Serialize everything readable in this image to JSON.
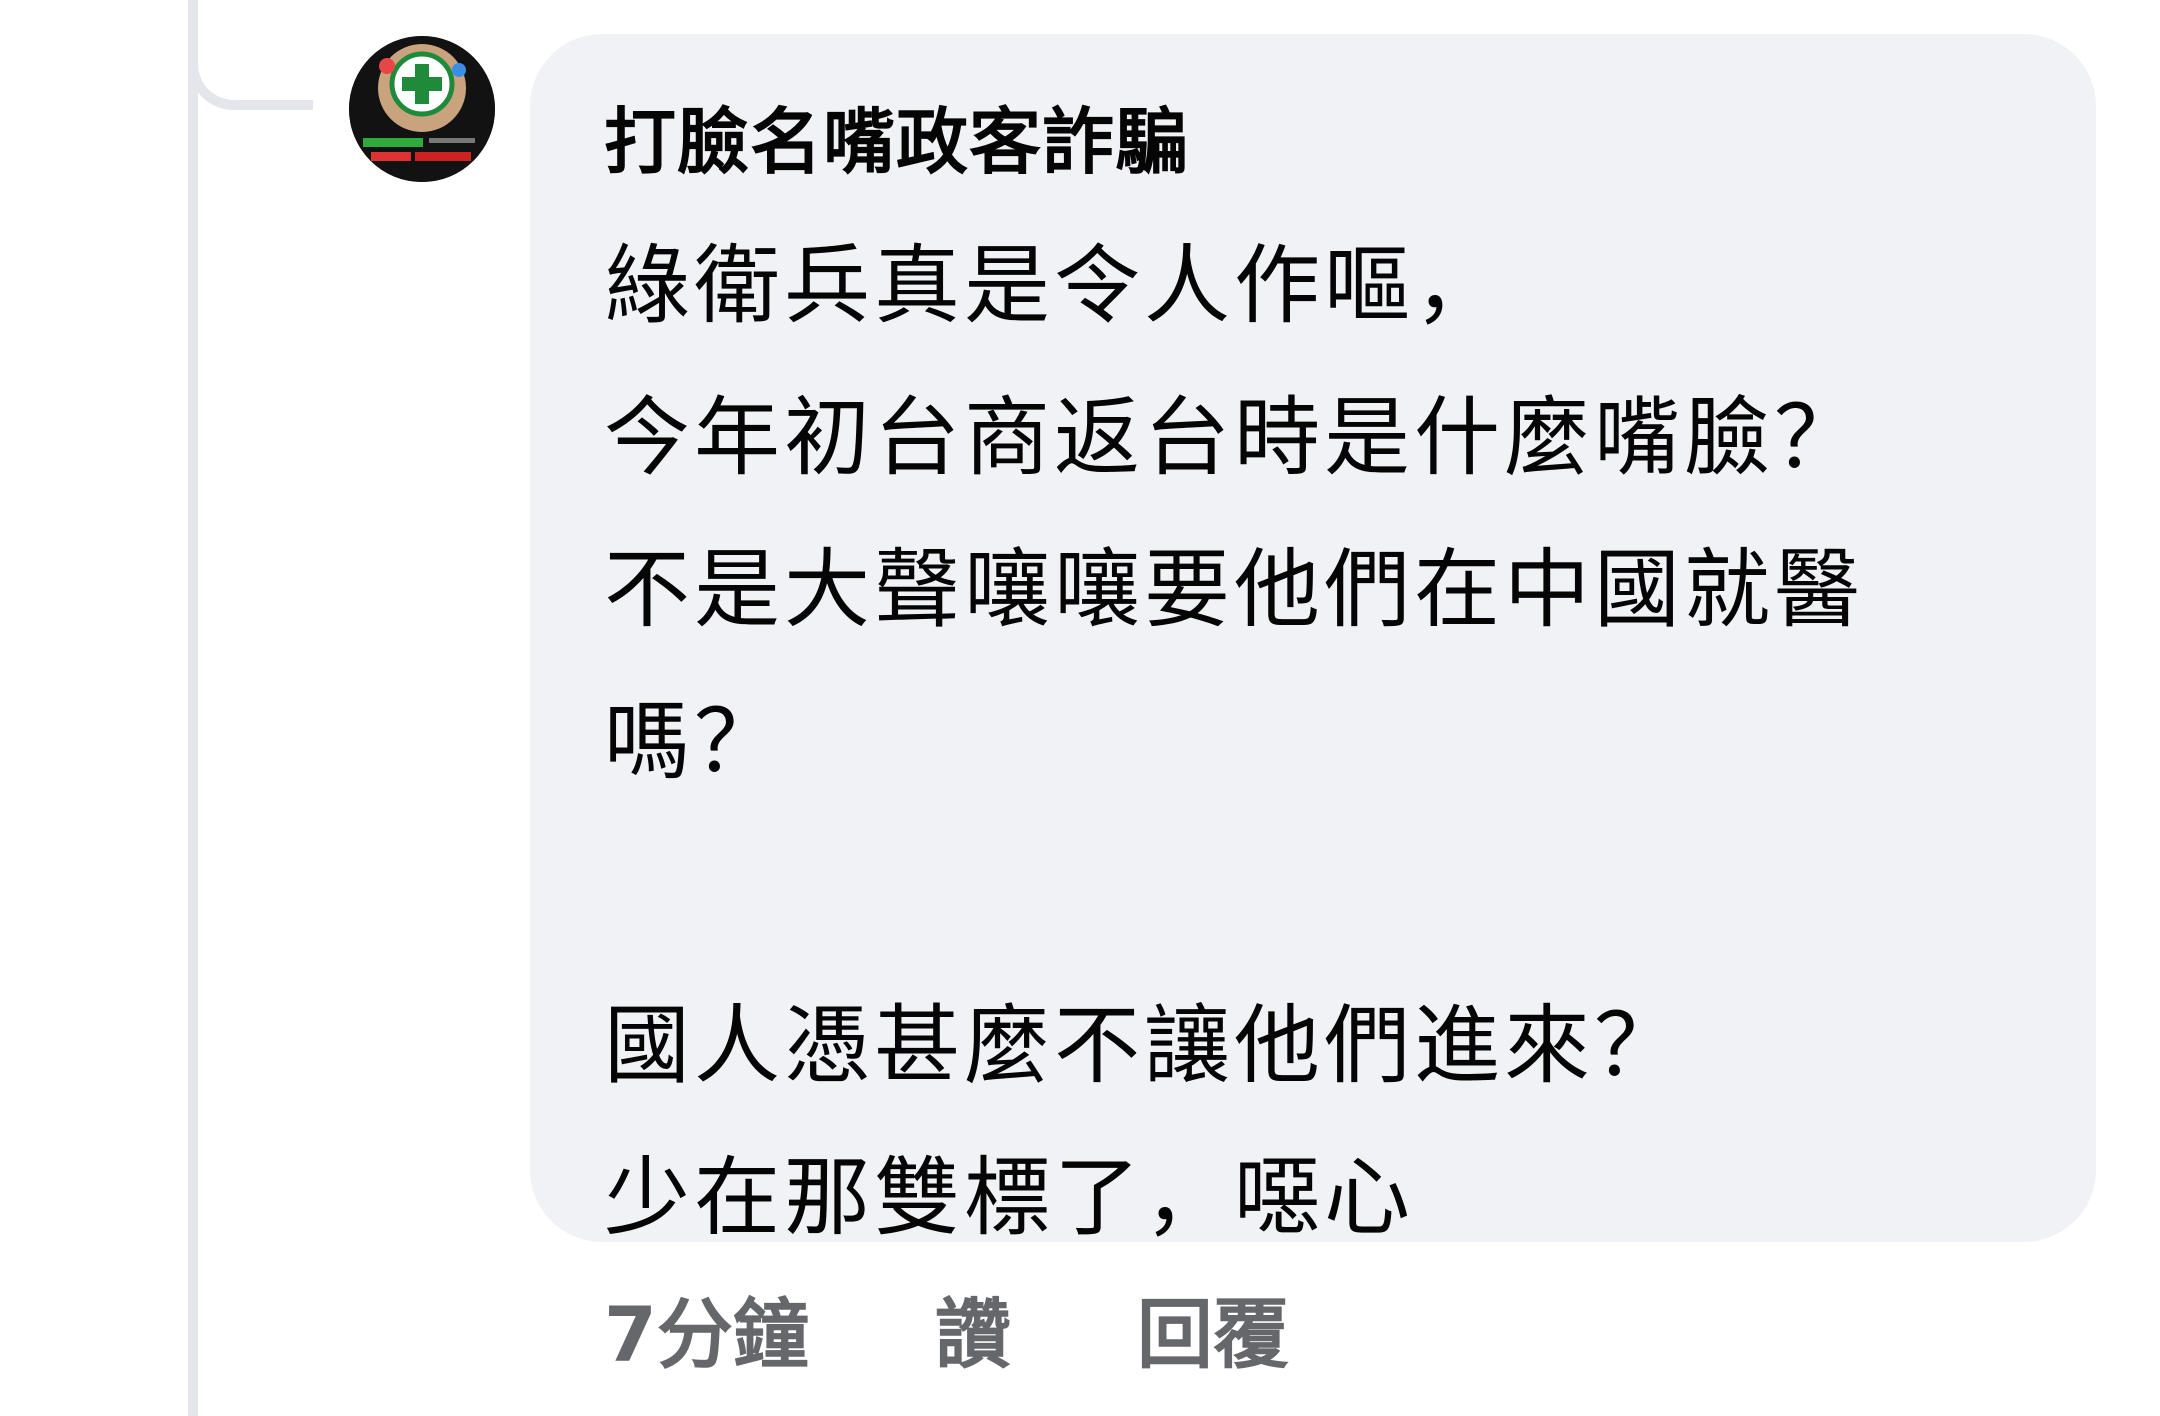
{
  "comment": {
    "author": "打臉名嘴政客詐騙",
    "lines": [
      "綠衛兵真是令人作嘔，",
      "今年初台商返台時是什麼嘴臉？",
      "不是大聲嚷嚷要他們在中國就醫",
      "嗎？",
      "",
      "國人憑甚麼不讓他們進來？",
      "少在那雙標了，噁心"
    ],
    "timestamp": "7分鐘",
    "like_label": "讚",
    "reply_label": "回覆"
  },
  "colors": {
    "bubble": "#f0f2f5",
    "text": "#050505",
    "meta": "#65676b",
    "thread_line": "#e4e6eb"
  },
  "icons": {
    "avatar": "party-flag-avatar"
  }
}
